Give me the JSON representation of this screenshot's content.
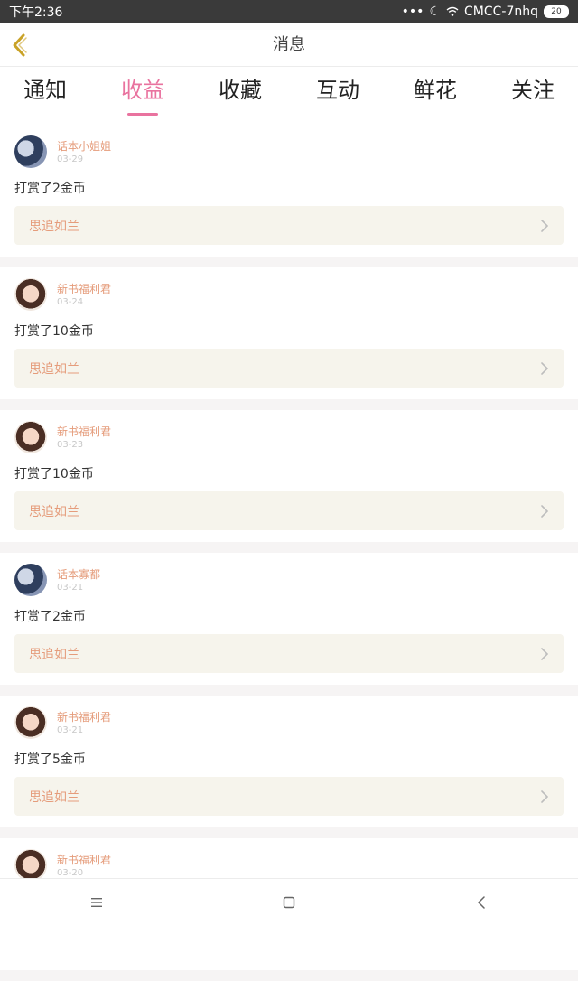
{
  "status": {
    "time": "下午2:36",
    "network": "CMCC-7nhq",
    "battery": "20"
  },
  "header": {
    "title": "消息"
  },
  "tabs": [
    {
      "label": "通知",
      "active": false
    },
    {
      "label": "收益",
      "active": true
    },
    {
      "label": "收藏",
      "active": false
    },
    {
      "label": "互动",
      "active": false
    },
    {
      "label": "鲜花",
      "active": false
    },
    {
      "label": "关注",
      "active": false
    }
  ],
  "messages": [
    {
      "user": "话本小姐姐",
      "date": "03-29",
      "text": "打赏了2金币",
      "book": "思追如兰",
      "avatar": "boy"
    },
    {
      "user": "新书福利君",
      "date": "03-24",
      "text": "打赏了10金币",
      "book": "思追如兰",
      "avatar": "girl"
    },
    {
      "user": "新书福利君",
      "date": "03-23",
      "text": "打赏了10金币",
      "book": "思追如兰",
      "avatar": "girl"
    },
    {
      "user": "话本寡都",
      "date": "03-21",
      "text": "打赏了2金币",
      "book": "思追如兰",
      "avatar": "boy"
    },
    {
      "user": "新书福利君",
      "date": "03-21",
      "text": "打赏了5金币",
      "book": "思追如兰",
      "avatar": "girl"
    },
    {
      "user": "新书福利君",
      "date": "03-20",
      "text": "",
      "book": "",
      "avatar": "girl"
    }
  ],
  "colors": {
    "accent": "#e9739f",
    "link": "#e59c7b",
    "back_icon": "#c9a227"
  }
}
